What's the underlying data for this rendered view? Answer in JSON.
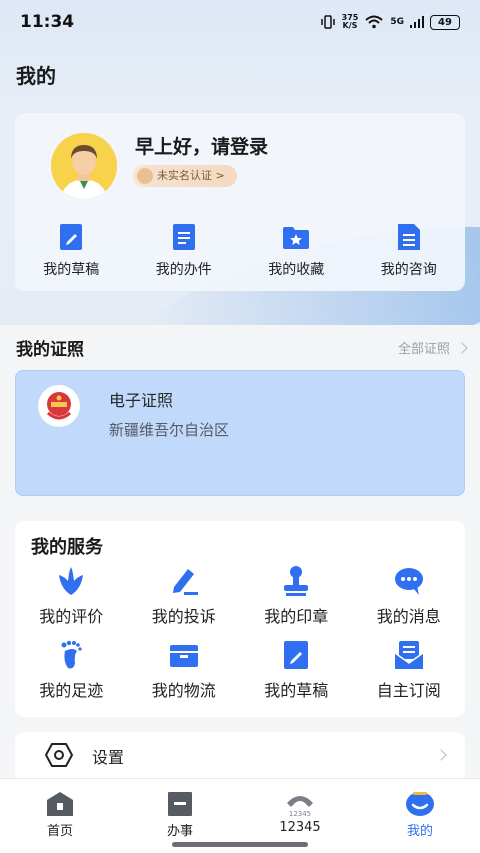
{
  "status_bar": {
    "time": "11:34",
    "speed_value": "375",
    "speed_unit": "K/S",
    "network": "5G",
    "battery": "49"
  },
  "page_title": "我的",
  "profile": {
    "greeting": "早上好，请登录",
    "auth_status": "未实名认证 >",
    "quick_actions": [
      {
        "label": "我的草稿",
        "icon": "draft-icon"
      },
      {
        "label": "我的办件",
        "icon": "document-icon"
      },
      {
        "label": "我的收藏",
        "icon": "favorite-folder-icon"
      },
      {
        "label": "我的咨询",
        "icon": "consult-icon"
      }
    ]
  },
  "certificates": {
    "title": "我的证照",
    "more_label": "全部证照",
    "card": {
      "title": "电子证照",
      "region": "新疆维吾尔自治区"
    }
  },
  "services": {
    "title": "我的服务",
    "items": [
      {
        "label": "我的评价",
        "icon": "evaluate-icon"
      },
      {
        "label": "我的投诉",
        "icon": "complaint-pen-icon"
      },
      {
        "label": "我的印章",
        "icon": "seal-stamp-icon"
      },
      {
        "label": "我的消息",
        "icon": "message-icon"
      },
      {
        "label": "我的足迹",
        "icon": "footprint-icon"
      },
      {
        "label": "我的物流",
        "icon": "logistics-box-icon"
      },
      {
        "label": "我的草稿",
        "icon": "draft-icon"
      },
      {
        "label": "自主订阅",
        "icon": "subscribe-icon"
      }
    ]
  },
  "settings": {
    "label": "设置"
  },
  "tabbar": {
    "tabs": [
      {
        "label": "首页",
        "icon": "home-icon"
      },
      {
        "label": "办事",
        "icon": "affairs-icon"
      },
      {
        "label": "12345",
        "icon": "hotline-icon"
      },
      {
        "label": "我的",
        "icon": "profile-icon",
        "active": true
      }
    ]
  },
  "colors": {
    "accent": "#2f6ff0",
    "icon_blue": "#2f6ff0",
    "cert_card": "#c1d9fa",
    "emblem_red": "#d9363e"
  }
}
